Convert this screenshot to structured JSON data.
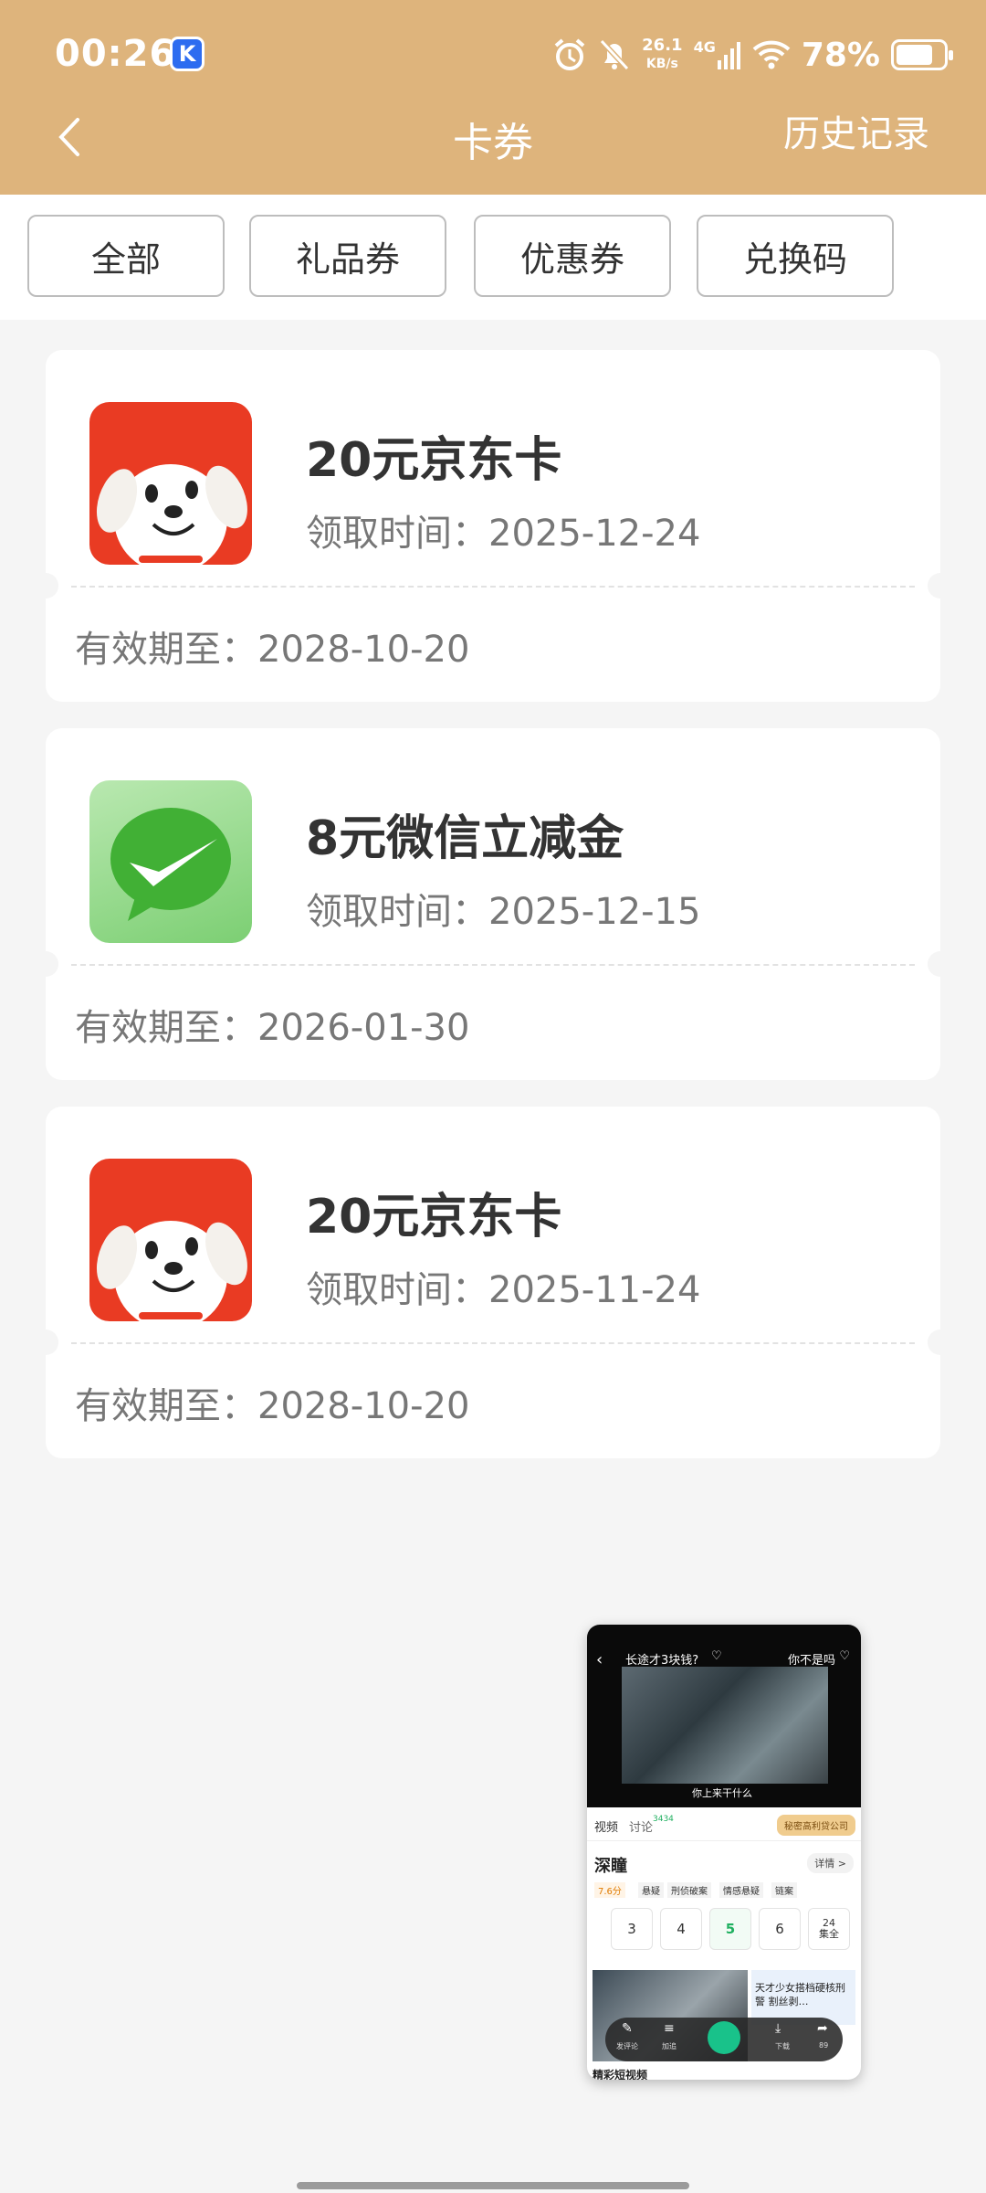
{
  "status_bar": {
    "time": "00:26",
    "k_badge": "K",
    "speed_value": "26.1",
    "speed_unit": "KB/s",
    "network": "4G",
    "battery": "78%",
    "battery_level": 0.78
  },
  "nav": {
    "back_icon": "chevron-left-icon",
    "title": "卡券",
    "history": "历史记录"
  },
  "filters": [
    {
      "label": "全部"
    },
    {
      "label": "礼品券"
    },
    {
      "label": "优惠券"
    },
    {
      "label": "兑换码"
    }
  ],
  "coupons": [
    {
      "title": "20元京东卡",
      "received": "领取时间：2025-12-24",
      "expire": "有效期至：2028-10-20",
      "logo": "jd-dog-logo"
    },
    {
      "title": "8元微信立减金",
      "received": "领取时间：2025-12-15",
      "expire": "有效期至：2026-01-30",
      "logo": "wechat-pay-logo"
    },
    {
      "title": "20元京东卡",
      "received": "领取时间：2025-11-24",
      "expire": "有效期至：2028-10-20",
      "logo": "jd-dog-logo"
    }
  ],
  "pip": {
    "top_left": "长途才3块钱?",
    "top_right": "你不是吗",
    "subtitle": "你上来干什么",
    "tab_video": "视频",
    "tab_comment": "讨论",
    "comment_count": "3434",
    "promo": "秘密高利贷公司",
    "show_title": "深瞳",
    "details": "详情 >",
    "rating": "7.6分",
    "tags": [
      "悬疑",
      "刑侦破案",
      "情感悬疑",
      "链案"
    ],
    "episodes": [
      "3",
      "4",
      "5",
      "6"
    ],
    "ep_total": "24\n集全",
    "promo_text": "天才少女搭档硬核刑警 割丝剥…",
    "bar_items": [
      "发评论",
      "加追",
      "下载",
      "89"
    ],
    "bottom_label": "精彩短视频"
  },
  "colors": {
    "header": "#deb47c",
    "background": "#f5f5f5",
    "jd_red": "#e93b23",
    "wechat_green": "#41b035"
  }
}
